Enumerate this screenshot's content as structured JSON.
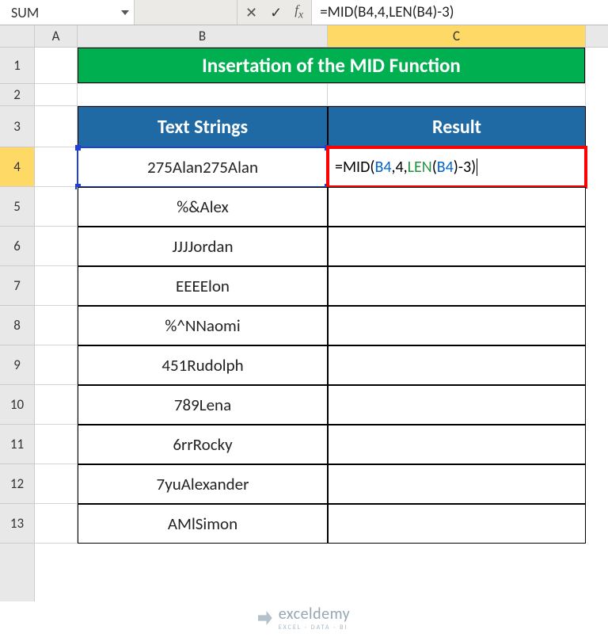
{
  "name_box": "SUM",
  "formula_text": "=MID(B4,4,LEN(B4)-3)",
  "columns": [
    "A",
    "B",
    "C"
  ],
  "row_numbers": [
    "1",
    "2",
    "3",
    "4",
    "5",
    "6",
    "7",
    "8",
    "9",
    "10",
    "11",
    "12",
    "13"
  ],
  "title": "Insertation of the MID Function",
  "headers": {
    "b": "Text Strings",
    "c": "Result"
  },
  "data": {
    "r4": "275Alan",
    "r5": "%&Alex",
    "r6": "JJJJordan",
    "r7": "EEEElon",
    "r8": "%^NNaomi",
    "r9": "451Rudolph",
    "r10": "789Lena",
    "r11": "6rrRocky",
    "r12": "7yuAlexander",
    "r13": "AMlSimon"
  },
  "edit_formula": {
    "p1": "=MID(",
    "p2": "B4",
    "p3": ",4,",
    "p4": "LEN",
    "p5": "(",
    "p6": "B4",
    "p7": ")",
    "p8": "-3)"
  },
  "watermark": {
    "brand": "exceldemy",
    "tag": "EXCEL · DATA · BI"
  },
  "chart_data": {
    "type": "table",
    "title": "Insertation of the MID Function",
    "columns": [
      "Text Strings",
      "Result"
    ],
    "rows": [
      [
        "275Alan",
        "=MID(B4,4,LEN(B4)-3)"
      ],
      [
        "%&Alex",
        ""
      ],
      [
        "JJJJordan",
        ""
      ],
      [
        "EEEElon",
        ""
      ],
      [
        "%^NNaomi",
        ""
      ],
      [
        "451Rudolph",
        ""
      ],
      [
        "789Lena",
        ""
      ],
      [
        "6rrRocky",
        ""
      ],
      [
        "7yuAlexander",
        ""
      ],
      [
        "AMlSimon",
        ""
      ]
    ]
  }
}
